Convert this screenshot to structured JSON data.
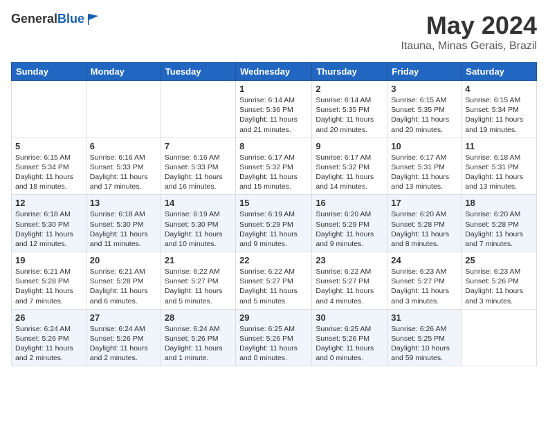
{
  "header": {
    "logo_general": "General",
    "logo_blue": "Blue",
    "month_title": "May 2024",
    "location": "Itauna, Minas Gerais, Brazil"
  },
  "weekdays": [
    "Sunday",
    "Monday",
    "Tuesday",
    "Wednesday",
    "Thursday",
    "Friday",
    "Saturday"
  ],
  "weeks": [
    [
      {
        "day": "",
        "info": ""
      },
      {
        "day": "",
        "info": ""
      },
      {
        "day": "",
        "info": ""
      },
      {
        "day": "1",
        "info": "Sunrise: 6:14 AM\nSunset: 5:36 PM\nDaylight: 11 hours and 21 minutes."
      },
      {
        "day": "2",
        "info": "Sunrise: 6:14 AM\nSunset: 5:35 PM\nDaylight: 11 hours and 20 minutes."
      },
      {
        "day": "3",
        "info": "Sunrise: 6:15 AM\nSunset: 5:35 PM\nDaylight: 11 hours and 20 minutes."
      },
      {
        "day": "4",
        "info": "Sunrise: 6:15 AM\nSunset: 5:34 PM\nDaylight: 11 hours and 19 minutes."
      }
    ],
    [
      {
        "day": "5",
        "info": "Sunrise: 6:15 AM\nSunset: 5:34 PM\nDaylight: 11 hours and 18 minutes."
      },
      {
        "day": "6",
        "info": "Sunrise: 6:16 AM\nSunset: 5:33 PM\nDaylight: 11 hours and 17 minutes."
      },
      {
        "day": "7",
        "info": "Sunrise: 6:16 AM\nSunset: 5:33 PM\nDaylight: 11 hours and 16 minutes."
      },
      {
        "day": "8",
        "info": "Sunrise: 6:17 AM\nSunset: 5:32 PM\nDaylight: 11 hours and 15 minutes."
      },
      {
        "day": "9",
        "info": "Sunrise: 6:17 AM\nSunset: 5:32 PM\nDaylight: 11 hours and 14 minutes."
      },
      {
        "day": "10",
        "info": "Sunrise: 6:17 AM\nSunset: 5:31 PM\nDaylight: 11 hours and 13 minutes."
      },
      {
        "day": "11",
        "info": "Sunrise: 6:18 AM\nSunset: 5:31 PM\nDaylight: 11 hours and 13 minutes."
      }
    ],
    [
      {
        "day": "12",
        "info": "Sunrise: 6:18 AM\nSunset: 5:30 PM\nDaylight: 11 hours and 12 minutes."
      },
      {
        "day": "13",
        "info": "Sunrise: 6:18 AM\nSunset: 5:30 PM\nDaylight: 11 hours and 11 minutes."
      },
      {
        "day": "14",
        "info": "Sunrise: 6:19 AM\nSunset: 5:30 PM\nDaylight: 11 hours and 10 minutes."
      },
      {
        "day": "15",
        "info": "Sunrise: 6:19 AM\nSunset: 5:29 PM\nDaylight: 11 hours and 9 minutes."
      },
      {
        "day": "16",
        "info": "Sunrise: 6:20 AM\nSunset: 5:29 PM\nDaylight: 11 hours and 9 minutes."
      },
      {
        "day": "17",
        "info": "Sunrise: 6:20 AM\nSunset: 5:28 PM\nDaylight: 11 hours and 8 minutes."
      },
      {
        "day": "18",
        "info": "Sunrise: 6:20 AM\nSunset: 5:28 PM\nDaylight: 11 hours and 7 minutes."
      }
    ],
    [
      {
        "day": "19",
        "info": "Sunrise: 6:21 AM\nSunset: 5:28 PM\nDaylight: 11 hours and 7 minutes."
      },
      {
        "day": "20",
        "info": "Sunrise: 6:21 AM\nSunset: 5:28 PM\nDaylight: 11 hours and 6 minutes."
      },
      {
        "day": "21",
        "info": "Sunrise: 6:22 AM\nSunset: 5:27 PM\nDaylight: 11 hours and 5 minutes."
      },
      {
        "day": "22",
        "info": "Sunrise: 6:22 AM\nSunset: 5:27 PM\nDaylight: 11 hours and 5 minutes."
      },
      {
        "day": "23",
        "info": "Sunrise: 6:22 AM\nSunset: 5:27 PM\nDaylight: 11 hours and 4 minutes."
      },
      {
        "day": "24",
        "info": "Sunrise: 6:23 AM\nSunset: 5:27 PM\nDaylight: 11 hours and 3 minutes."
      },
      {
        "day": "25",
        "info": "Sunrise: 6:23 AM\nSunset: 5:26 PM\nDaylight: 11 hours and 3 minutes."
      }
    ],
    [
      {
        "day": "26",
        "info": "Sunrise: 6:24 AM\nSunset: 5:26 PM\nDaylight: 11 hours and 2 minutes."
      },
      {
        "day": "27",
        "info": "Sunrise: 6:24 AM\nSunset: 5:26 PM\nDaylight: 11 hours and 2 minutes."
      },
      {
        "day": "28",
        "info": "Sunrise: 6:24 AM\nSunset: 5:26 PM\nDaylight: 11 hours and 1 minute."
      },
      {
        "day": "29",
        "info": "Sunrise: 6:25 AM\nSunset: 5:26 PM\nDaylight: 11 hours and 0 minutes."
      },
      {
        "day": "30",
        "info": "Sunrise: 6:25 AM\nSunset: 5:26 PM\nDaylight: 11 hours and 0 minutes."
      },
      {
        "day": "31",
        "info": "Sunrise: 6:26 AM\nSunset: 5:25 PM\nDaylight: 10 hours and 59 minutes."
      },
      {
        "day": "",
        "info": ""
      }
    ]
  ]
}
